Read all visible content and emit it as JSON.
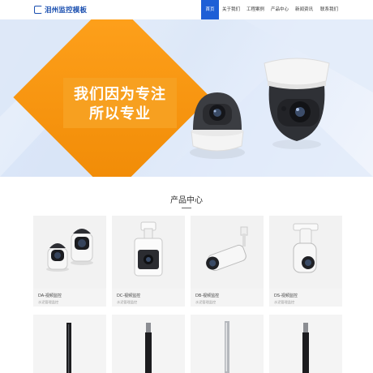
{
  "header": {
    "logo_text": "泪州监控模板",
    "nav": [
      "首页",
      "关于我们",
      "工程案例",
      "产品中心",
      "新闻资讯",
      "联系我们"
    ],
    "active_index": 0,
    "brand_color": "#1e5fd6"
  },
  "banner": {
    "slogan_line1": "我们因为专注",
    "slogan_line2": "所以专业",
    "accent_color": "#f7a020",
    "slides": 3,
    "active_slide": 1
  },
  "products": {
    "title": "产品中心",
    "items": [
      {
        "title": "DA-视频监控",
        "sub": "水泥管理监控"
      },
      {
        "title": "DC-视频监控",
        "sub": "水泥管理监控"
      },
      {
        "title": "DB-视频监控",
        "sub": "水泥管理监控"
      },
      {
        "title": "DS-视频监控",
        "sub": "水泥管理监控"
      }
    ]
  }
}
